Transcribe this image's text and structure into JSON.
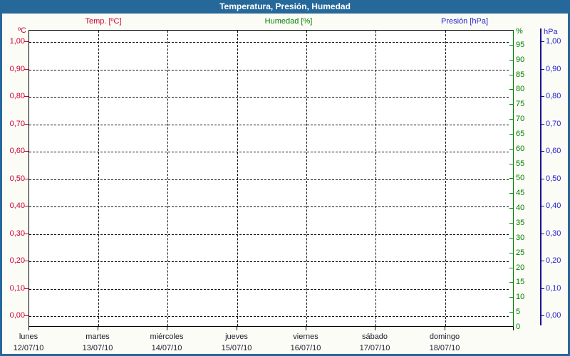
{
  "window": {
    "title": "Temperatura, Presión, Humedad"
  },
  "colors": {
    "titlebar_bg": "#26689a",
    "titlebar_fg": "#ffffff",
    "frame_border": "#26689a",
    "page_bg": "#fcfcf6",
    "plot_bg": "#ffffff",
    "grid": "#111111",
    "temp": "#cc0033",
    "humidity": "#007e00",
    "pressure_text": "#2222cc",
    "pressure_line": "#15158a",
    "x_label_text": "#1c1c2e"
  },
  "legend": {
    "temp_label": "Temp. [ºC]",
    "humidity_label": "Humedad [%]",
    "pressure_label": "Presión [hPa]"
  },
  "axes": {
    "left_temp": {
      "unit": "ºC",
      "ticks": [
        "1,00",
        "0,90",
        "0,80",
        "0,70",
        "0,60",
        "0,50",
        "0,40",
        "0,30",
        "0,20",
        "0,10",
        "0,00"
      ]
    },
    "right_humidity": {
      "unit": "%",
      "ticks": [
        "95",
        "90",
        "85",
        "80",
        "75",
        "70",
        "65",
        "60",
        "55",
        "50",
        "45",
        "40",
        "35",
        "30",
        "25",
        "20",
        "15",
        "10",
        "5",
        "0"
      ]
    },
    "right_pressure": {
      "unit": "hPa",
      "ticks": [
        "1,00",
        "0,90",
        "0,80",
        "0,70",
        "0,60",
        "0,50",
        "0,40",
        "0,30",
        "0,20",
        "0,10",
        "0,00"
      ]
    }
  },
  "x_axis": {
    "days": [
      {
        "name": "lunes",
        "date": "12/07/10"
      },
      {
        "name": "martes",
        "date": "13/07/10"
      },
      {
        "name": "miércoles",
        "date": "14/07/10"
      },
      {
        "name": "jueves",
        "date": "15/07/10"
      },
      {
        "name": "viernes",
        "date": "16/07/10"
      },
      {
        "name": "sábado",
        "date": "17/07/10"
      },
      {
        "name": "domingo",
        "date": "18/07/10"
      }
    ]
  },
  "chart_data": {
    "type": "line",
    "title": "Temperatura, Presión, Humedad",
    "x": {
      "categories": [
        "12/07/10",
        "13/07/10",
        "14/07/10",
        "15/07/10",
        "16/07/10",
        "17/07/10",
        "18/07/10"
      ],
      "weekday_labels": [
        "lunes",
        "martes",
        "miércoles",
        "jueves",
        "viernes",
        "sábado",
        "domingo"
      ]
    },
    "series": [],
    "y_axes": [
      {
        "name": "Temp. [ºC]",
        "side": "left",
        "color": "#cc0033",
        "min": 0.0,
        "max": 1.0,
        "step": 0.1
      },
      {
        "name": "Humedad [%]",
        "side": "right",
        "color": "#007e00",
        "min": 0,
        "max": 100,
        "step": 5
      },
      {
        "name": "Presión [hPa]",
        "side": "right",
        "color": "#2222cc",
        "min": 0.0,
        "max": 1.0,
        "step": 0.1
      }
    ],
    "grid": true,
    "legend_position": "top",
    "notes": "Plot area is empty — no data series drawn"
  }
}
